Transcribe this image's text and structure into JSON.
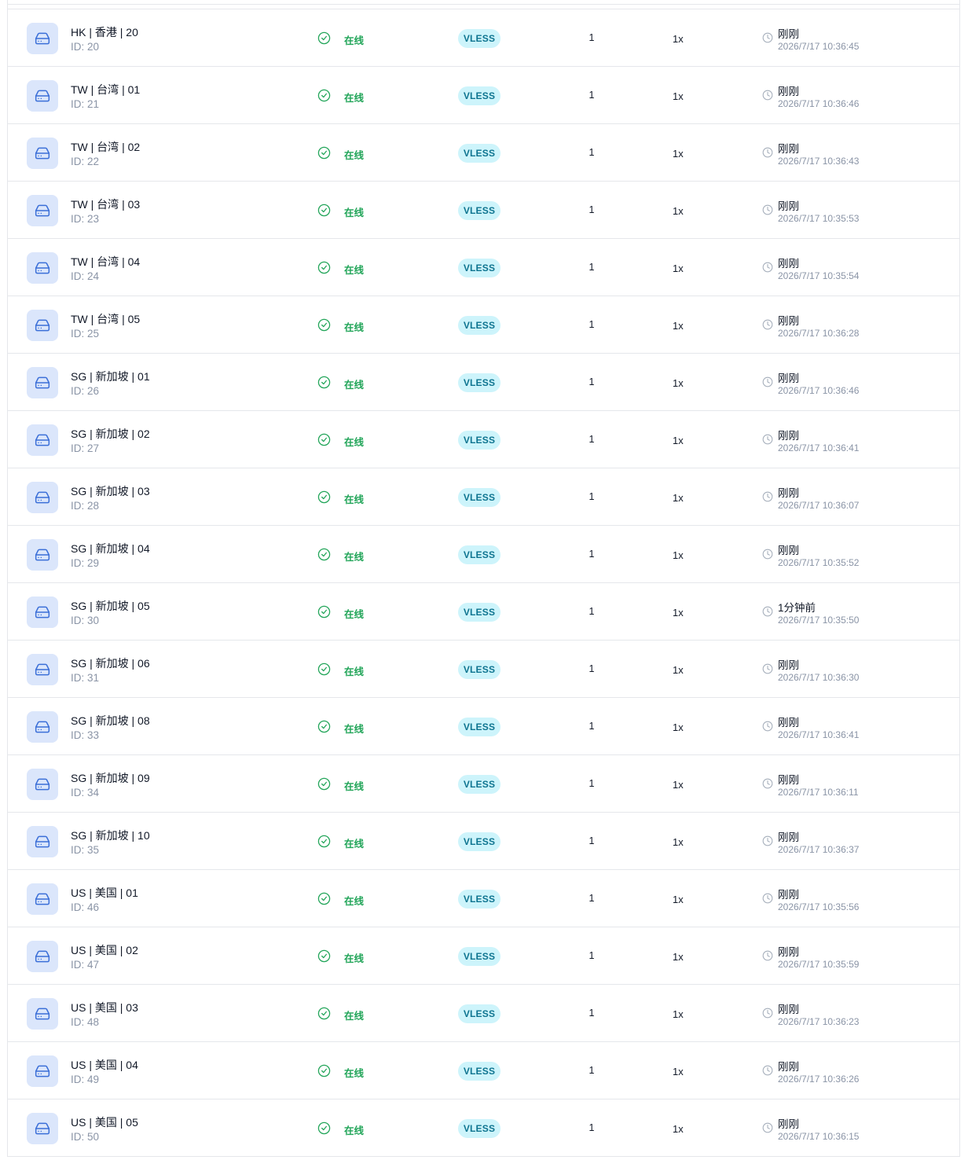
{
  "colors": {
    "online": "#22a559",
    "icon_bg": "#dbe6fb",
    "icon_fg": "#3b6fd8",
    "badge_bg": "#cdf4fb",
    "badge_fg": "#0e7490",
    "muted": "#8a94a6",
    "divider": "#e5e7eb"
  },
  "icons": {
    "node": "hard-drive-icon",
    "status": "check-circle-icon",
    "last_seen": "clock-icon"
  },
  "rows": [
    {
      "name": "HK | 香港 | 20",
      "id": "ID: 20",
      "status": "在线",
      "protocol": "VLESS",
      "count": "1",
      "rate": "1x",
      "last_seen": "刚刚",
      "timestamp": "2026/7/17 10:36:45"
    },
    {
      "name": "TW | 台湾 | 01",
      "id": "ID: 21",
      "status": "在线",
      "protocol": "VLESS",
      "count": "1",
      "rate": "1x",
      "last_seen": "刚刚",
      "timestamp": "2026/7/17 10:36:46"
    },
    {
      "name": "TW | 台湾 | 02",
      "id": "ID: 22",
      "status": "在线",
      "protocol": "VLESS",
      "count": "1",
      "rate": "1x",
      "last_seen": "刚刚",
      "timestamp": "2026/7/17 10:36:43"
    },
    {
      "name": "TW | 台湾 | 03",
      "id": "ID: 23",
      "status": "在线",
      "protocol": "VLESS",
      "count": "1",
      "rate": "1x",
      "last_seen": "刚刚",
      "timestamp": "2026/7/17 10:35:53"
    },
    {
      "name": "TW | 台湾 | 04",
      "id": "ID: 24",
      "status": "在线",
      "protocol": "VLESS",
      "count": "1",
      "rate": "1x",
      "last_seen": "刚刚",
      "timestamp": "2026/7/17 10:35:54"
    },
    {
      "name": "TW | 台湾 | 05",
      "id": "ID: 25",
      "status": "在线",
      "protocol": "VLESS",
      "count": "1",
      "rate": "1x",
      "last_seen": "刚刚",
      "timestamp": "2026/7/17 10:36:28"
    },
    {
      "name": "SG | 新加坡 | 01",
      "id": "ID: 26",
      "status": "在线",
      "protocol": "VLESS",
      "count": "1",
      "rate": "1x",
      "last_seen": "刚刚",
      "timestamp": "2026/7/17 10:36:46"
    },
    {
      "name": "SG | 新加坡 | 02",
      "id": "ID: 27",
      "status": "在线",
      "protocol": "VLESS",
      "count": "1",
      "rate": "1x",
      "last_seen": "刚刚",
      "timestamp": "2026/7/17 10:36:41"
    },
    {
      "name": "SG | 新加坡 | 03",
      "id": "ID: 28",
      "status": "在线",
      "protocol": "VLESS",
      "count": "1",
      "rate": "1x",
      "last_seen": "刚刚",
      "timestamp": "2026/7/17 10:36:07"
    },
    {
      "name": "SG | 新加坡 | 04",
      "id": "ID: 29",
      "status": "在线",
      "protocol": "VLESS",
      "count": "1",
      "rate": "1x",
      "last_seen": "刚刚",
      "timestamp": "2026/7/17 10:35:52"
    },
    {
      "name": "SG | 新加坡 | 05",
      "id": "ID: 30",
      "status": "在线",
      "protocol": "VLESS",
      "count": "1",
      "rate": "1x",
      "last_seen": "1分钟前",
      "timestamp": "2026/7/17 10:35:50"
    },
    {
      "name": "SG | 新加坡 | 06",
      "id": "ID: 31",
      "status": "在线",
      "protocol": "VLESS",
      "count": "1",
      "rate": "1x",
      "last_seen": "刚刚",
      "timestamp": "2026/7/17 10:36:30"
    },
    {
      "name": "SG | 新加坡 | 08",
      "id": "ID: 33",
      "status": "在线",
      "protocol": "VLESS",
      "count": "1",
      "rate": "1x",
      "last_seen": "刚刚",
      "timestamp": "2026/7/17 10:36:41"
    },
    {
      "name": "SG | 新加坡 | 09",
      "id": "ID: 34",
      "status": "在线",
      "protocol": "VLESS",
      "count": "1",
      "rate": "1x",
      "last_seen": "刚刚",
      "timestamp": "2026/7/17 10:36:11"
    },
    {
      "name": "SG | 新加坡 | 10",
      "id": "ID: 35",
      "status": "在线",
      "protocol": "VLESS",
      "count": "1",
      "rate": "1x",
      "last_seen": "刚刚",
      "timestamp": "2026/7/17 10:36:37"
    },
    {
      "name": "US | 美国 | 01",
      "id": "ID: 46",
      "status": "在线",
      "protocol": "VLESS",
      "count": "1",
      "rate": "1x",
      "last_seen": "刚刚",
      "timestamp": "2026/7/17 10:35:56"
    },
    {
      "name": "US | 美国 | 02",
      "id": "ID: 47",
      "status": "在线",
      "protocol": "VLESS",
      "count": "1",
      "rate": "1x",
      "last_seen": "刚刚",
      "timestamp": "2026/7/17 10:35:59"
    },
    {
      "name": "US | 美国 | 03",
      "id": "ID: 48",
      "status": "在线",
      "protocol": "VLESS",
      "count": "1",
      "rate": "1x",
      "last_seen": "刚刚",
      "timestamp": "2026/7/17 10:36:23"
    },
    {
      "name": "US | 美国 | 04",
      "id": "ID: 49",
      "status": "在线",
      "protocol": "VLESS",
      "count": "1",
      "rate": "1x",
      "last_seen": "刚刚",
      "timestamp": "2026/7/17 10:36:26"
    },
    {
      "name": "US | 美国 | 05",
      "id": "ID: 50",
      "status": "在线",
      "protocol": "VLESS",
      "count": "1",
      "rate": "1x",
      "last_seen": "刚刚",
      "timestamp": "2026/7/17 10:36:15"
    }
  ]
}
